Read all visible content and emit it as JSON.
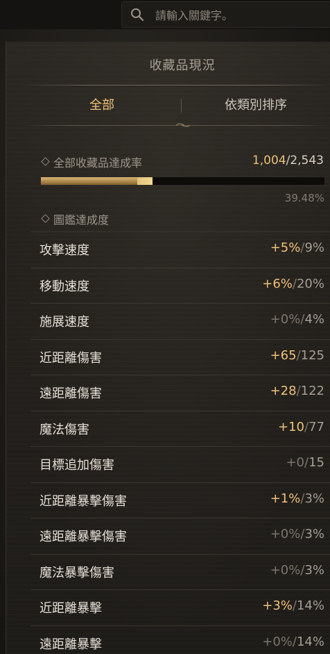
{
  "search": {
    "placeholder": "請輸入關鍵字。"
  },
  "panel": {
    "title": "收藏品現況",
    "tabs": [
      {
        "label": "全部",
        "active": true
      },
      {
        "label": "依類別排序",
        "active": false
      }
    ]
  },
  "achievement": {
    "label": "全部收藏品達成率",
    "current": "1,004",
    "separator": "/",
    "total": "2,543",
    "progress_fraction": 0.3948,
    "percent_text": "39.48%"
  },
  "codex": {
    "label": "圖鑑達成度",
    "rows": [
      {
        "name": "攻擊速度",
        "bonus": "+5%",
        "sep": "/",
        "max": "9%",
        "active": true
      },
      {
        "name": "移動速度",
        "bonus": "+6%",
        "sep": "/",
        "max": "20%",
        "active": true
      },
      {
        "name": "施展速度",
        "bonus": "+0%",
        "sep": "/",
        "max": "4%",
        "active": false
      },
      {
        "name": "近距離傷害",
        "bonus": "+65",
        "sep": "/",
        "max": "125",
        "active": true
      },
      {
        "name": "遠距離傷害",
        "bonus": "+28",
        "sep": "/",
        "max": "122",
        "active": true
      },
      {
        "name": "魔法傷害",
        "bonus": "+10",
        "sep": "/",
        "max": "77",
        "active": true
      },
      {
        "name": "目標追加傷害",
        "bonus": "+0",
        "sep": "/",
        "max": "15",
        "active": false
      },
      {
        "name": "近距離暴擊傷害",
        "bonus": "+1%",
        "sep": "/",
        "max": "3%",
        "active": true
      },
      {
        "name": "遠距離暴擊傷害",
        "bonus": "+0%",
        "sep": "/",
        "max": "3%",
        "active": false
      },
      {
        "name": "魔法暴擊傷害",
        "bonus": "+0%",
        "sep": "/",
        "max": "3%",
        "active": false
      },
      {
        "name": "近距離暴擊",
        "bonus": "+3%",
        "sep": "/",
        "max": "14%",
        "active": true
      },
      {
        "name": "遠距離暴擊",
        "bonus": "+0%",
        "sep": "/",
        "max": "14%",
        "active": false
      }
    ]
  },
  "colors": {
    "accent": "#f0c178",
    "text": "#e6e0d6",
    "muted": "#7c766c"
  }
}
